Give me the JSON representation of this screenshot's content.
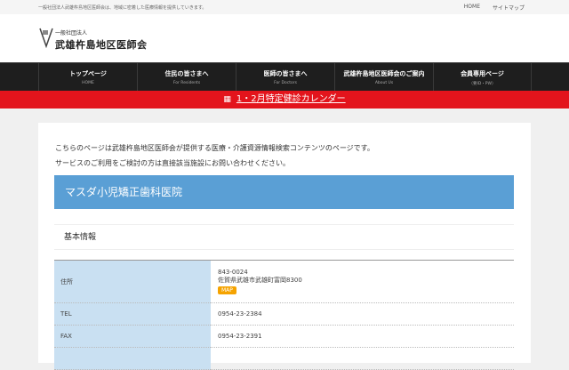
{
  "topbar": {
    "tagline": "一般社団法人武雄杵島地区医師会は、地域に密着した医療情報を提供していきます。",
    "links": [
      "HOME",
      "サイトマップ"
    ]
  },
  "logo": {
    "line1": "一般社団法人",
    "line2": "武雄杵島地区医師会"
  },
  "nav": [
    {
      "jp": "トップページ",
      "en": "HOME"
    },
    {
      "jp": "住民の皆さまへ",
      "en": "For Residents"
    },
    {
      "jp": "医師の皆さまへ",
      "en": "For Doctors"
    },
    {
      "jp": "武雄杵島地区医師会のご案内",
      "en": "About Us"
    },
    {
      "jp": "会員専用ページ",
      "en": "（要ID・PW）"
    }
  ],
  "banner": {
    "icon": "calendar-icon",
    "label": "1・2月特定健診カレンダー"
  },
  "intro": [
    "こちらのページは武雄杵島地区医師会が提供する医療・介護資源情報検索コンテンツのページです。",
    "サービスのご利用をご検討の方は直接該当施設にお問い合わせください。"
  ],
  "facility": {
    "name": "マスダ小児矯正歯科医院"
  },
  "section": "基本情報",
  "table": {
    "address": {
      "label": "住所",
      "postal": "843-0024",
      "address": "佐賀県武雄市武雄町富岡8300",
      "map": "MAP"
    },
    "tel": {
      "label": "TEL",
      "value": "0954-23-2384"
    },
    "fax": {
      "label": "FAX",
      "value": "0954-23-2391"
    }
  },
  "colors": {
    "nav": "#1e1e1e",
    "banner": "#e3141c",
    "title": "#5a9fd5",
    "label_cell": "#c9e0f2",
    "map": "#f5a300"
  }
}
